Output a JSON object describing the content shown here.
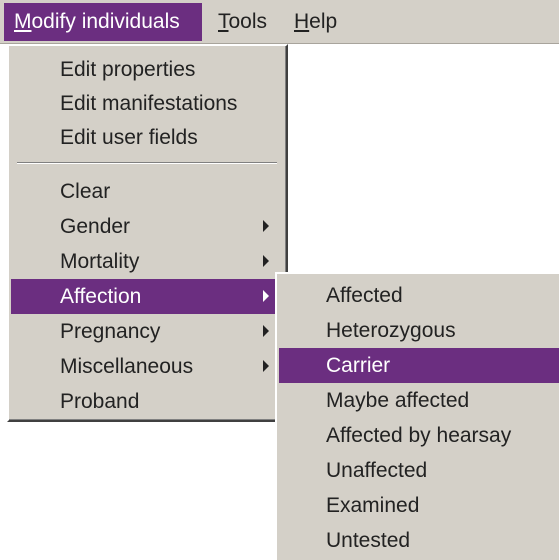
{
  "menubar": {
    "modify": {
      "prefix": "",
      "underline": "M",
      "rest": "odify individuals"
    },
    "tools": {
      "prefix": "",
      "underline": "T",
      "rest": "ools"
    },
    "help": {
      "prefix": "",
      "underline": "H",
      "rest": "elp"
    }
  },
  "main_menu": {
    "items": [
      {
        "label": "Edit properties"
      },
      {
        "label": "Edit manifestations"
      },
      {
        "label": "Edit user fields"
      },
      {
        "label": "Clear"
      },
      {
        "label": "Gender"
      },
      {
        "label": "Mortality"
      },
      {
        "label": "Affection"
      },
      {
        "label": "Pregnancy"
      },
      {
        "label": "Miscellaneous"
      },
      {
        "label": "Proband"
      }
    ]
  },
  "affection_submenu": {
    "items": [
      {
        "label": "Affected"
      },
      {
        "label": "Heterozygous"
      },
      {
        "label": "Carrier"
      },
      {
        "label": "Maybe affected"
      },
      {
        "label": "Affected by hearsay"
      },
      {
        "label": "Unaffected"
      },
      {
        "label": "Examined"
      },
      {
        "label": "Untested"
      }
    ]
  },
  "colors": {
    "highlight": "#6b2e80",
    "menu_face": "#d4d0c8",
    "text": "#222222"
  }
}
